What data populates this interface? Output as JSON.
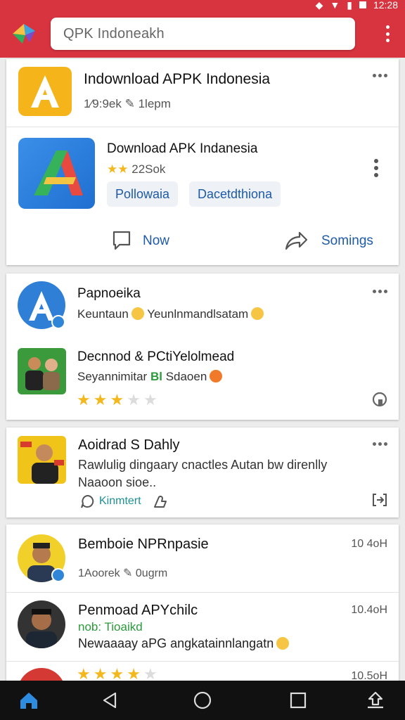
{
  "status": {
    "time": "12:28"
  },
  "search": {
    "text": "QPK Indoneakh"
  },
  "colors": {
    "appbar": "#d8343f",
    "link": "#1e5aa6",
    "star": "#f3b81e"
  },
  "card1": {
    "title": "Indownload APPK Indonesia",
    "meta_left": "1⁄9:9ek",
    "meta_right": "1lepm",
    "app": {
      "title": "Download APK Indanesia",
      "rating_text": "22Sok",
      "chips": [
        "Pollowaia",
        "Dacetdthiona"
      ],
      "actions": {
        "left": "Now",
        "right": "Somings"
      }
    }
  },
  "card2": {
    "post1": {
      "title": "Papnoeika",
      "text_a": "Keuntaun",
      "text_b": "Yeunlnmandlsatam"
    },
    "post2": {
      "title": "Decnnod & PCtiYelolmead",
      "text_a": "Seyannimitar",
      "text_green": "Bl",
      "text_b": "Sdaoen",
      "rating": 3,
      "max_rating": 5
    }
  },
  "card3": {
    "title": "Aoidrad S Dahly",
    "body": "Rawlulig dingaary cnactles Autan bw direnlly Naaoon sioe..",
    "link": "Kinmtert"
  },
  "card4": {
    "post1": {
      "title": "Bemboie NPRnpasie",
      "time": "10 4oH",
      "meta_left": "1Aoorek",
      "meta_right": "0ugrm"
    },
    "post2": {
      "title": "Penmoad APYchilc",
      "time": "10.4oH",
      "green_tag": "nob: Tioaikd",
      "body": "Newaaaay aPG angkatainnlangatn"
    },
    "post3": {
      "time": "10.5oH",
      "rating": 4,
      "max_rating": 5
    }
  },
  "navbar": {
    "items": [
      "home-icon",
      "back-icon",
      "home-circle-icon",
      "recents-icon",
      "share-icon"
    ]
  }
}
